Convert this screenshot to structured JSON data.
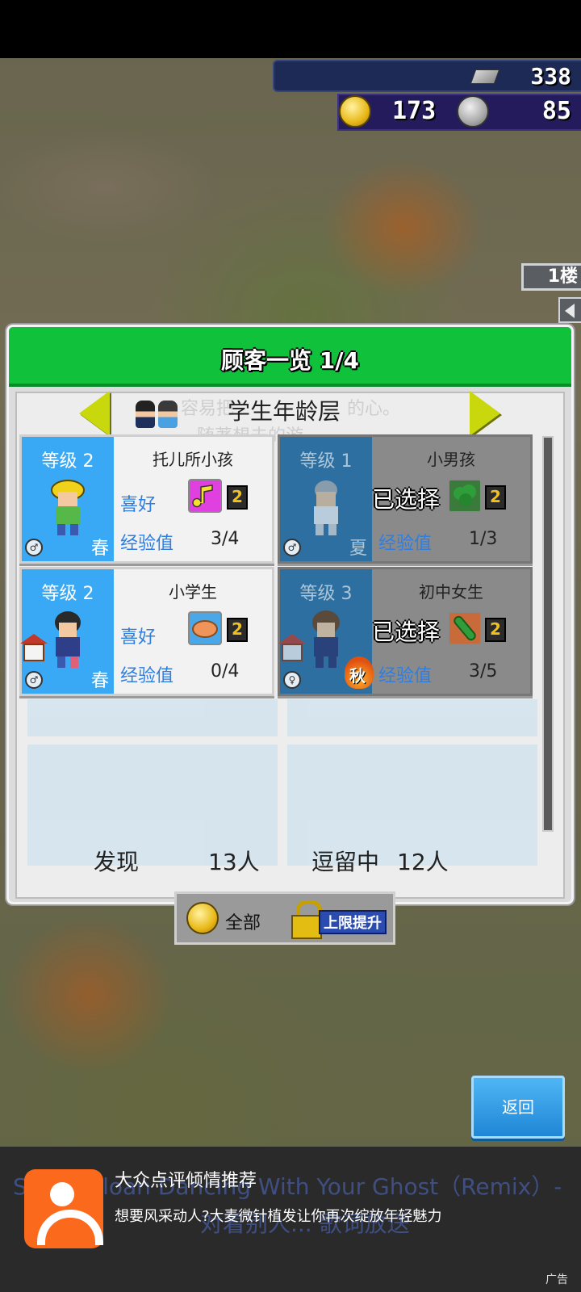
{
  "resources": {
    "bricks": "338",
    "research_points": "173",
    "coins": "85"
  },
  "floor_button": "1楼",
  "dialog": {
    "title": "顾客一览 1/4",
    "category_title": "学生年龄层",
    "ghost_lines": [
      "容易把",
      "的心。",
      "随著想去的游"
    ],
    "cards": [
      {
        "level": "等级 2",
        "name": "托儿所小孩",
        "like_label": "喜好",
        "like_level": "2",
        "exp_label": "经验值",
        "exp_value": "3/4",
        "season": "春",
        "selected_text": "",
        "like_item": "music-note-icon"
      },
      {
        "level": "等级 1",
        "name": "小男孩",
        "like_label": "喜好",
        "like_level": "2",
        "exp_label": "经验值",
        "exp_value": "1/3",
        "season": "夏",
        "selected_text": "已选择",
        "like_item": "broccoli-icon"
      },
      {
        "level": "等级 2",
        "name": "小学生",
        "like_label": "喜好",
        "like_level": "2",
        "exp_label": "经验值",
        "exp_value": "0/4",
        "season": "春",
        "selected_text": "",
        "like_item": "bread-icon"
      },
      {
        "level": "等级 3",
        "name": "初中女生",
        "like_label": "喜好",
        "like_level": "2",
        "exp_label": "经验值",
        "exp_value": "3/5",
        "season": "秋",
        "selected_text": "已选择",
        "like_item": "cucumber-icon"
      }
    ],
    "found_label": "发现",
    "found_value": "13人",
    "staying_label": "逗留中",
    "staying_value": "12人"
  },
  "filter_bar": {
    "all_label": "全部",
    "upgrade_label": "上限提升"
  },
  "back_button": "返回",
  "ad": {
    "title": "大众点评倾情推荐",
    "description": "想要风采动人?大麦微针植发让你再次绽放年轻魅力",
    "badge": "广告",
    "ghost_line1": "Sasha Sloan Dancing With Your Ghost（Remix）- ",
    "ghost_line2": "对着别人... 歌词放送"
  }
}
